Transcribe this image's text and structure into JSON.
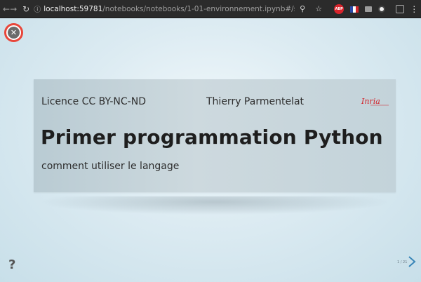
{
  "browser": {
    "address_info": "ⓘ",
    "address_host": "localhost:59781",
    "address_path": "/notebooks/notebooks/1-01-environnement.ipynb#/slide-...",
    "icons": [
      "back-icon",
      "forward-icon",
      "reload-icon",
      "zoom-icon",
      "star-icon",
      "adblock-icon",
      "french-flag-icon",
      "message-icon",
      "extension-icon",
      "extension-icon-2",
      "menu-icon"
    ]
  },
  "slide": {
    "licence": "Licence CC BY-NC-ND",
    "author": "Thierry Parmentelat",
    "logo_text": "Inria",
    "title": "Primer programmation Python",
    "subtitle": "comment utiliser le langage",
    "help": "?",
    "count": "1 / 21"
  },
  "colors": {
    "close_ring": "#e8463a",
    "close_fill": "#6b6b6b",
    "logo_red": "#d2232a",
    "next_arrow": "#3a86b8"
  }
}
